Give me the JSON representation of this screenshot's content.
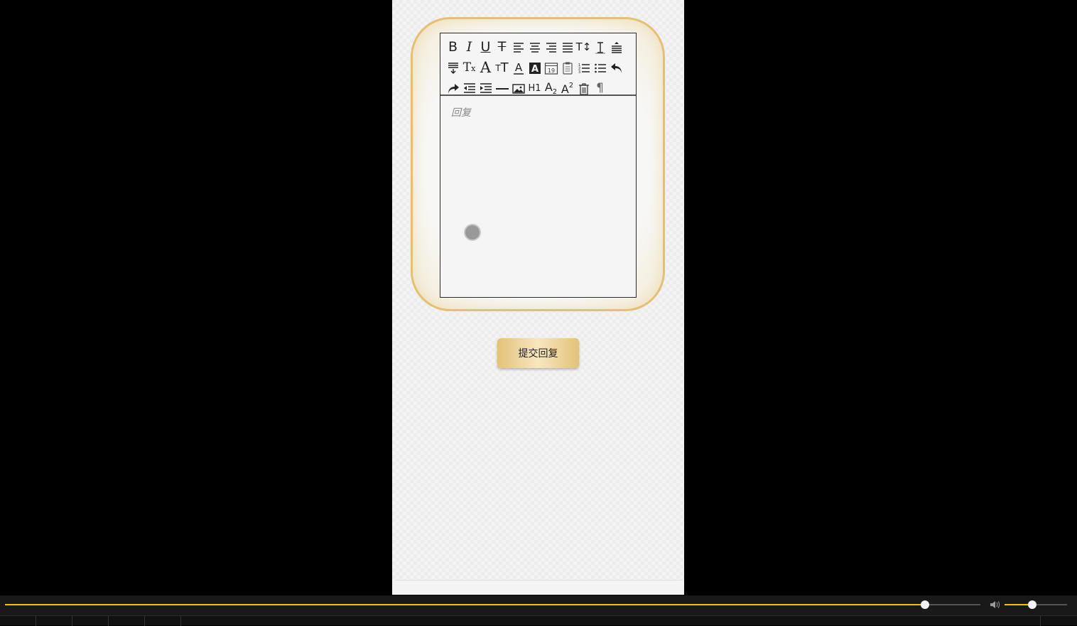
{
  "editor": {
    "placeholder": "回复",
    "toolbar_rows": [
      [
        "bold-icon",
        "italic-icon",
        "underline-icon",
        "strikethrough-icon",
        "align-left-icon",
        "align-center-icon",
        "align-right-icon",
        "align-justify-icon",
        "text-size-icon",
        "line-height-icon",
        "paragraph-before-icon"
      ],
      [
        "paragraph-after-icon",
        "clear-format-icon",
        "font-family-icon",
        "font-size-icon",
        "font-color-icon",
        "background-color-icon",
        "date-icon",
        "clipboard-icon",
        "ordered-list-icon",
        "unordered-list-icon",
        "undo-icon"
      ],
      [
        "redo-icon",
        "outdent-icon",
        "indent-icon",
        "horizontal-rule-icon",
        "image-icon",
        "heading-icon",
        "subscript-icon",
        "superscript-icon",
        "delete-icon",
        "pilcrow-icon"
      ]
    ],
    "labels": {
      "heading": "H1"
    }
  },
  "submit": {
    "label": "提交回复"
  },
  "player": {
    "progress": 0.943,
    "volume": 0.44,
    "accent_color": "#f0c300"
  },
  "colors": {
    "frame_border": "#e5c074",
    "button_gold": "#e3c27a"
  }
}
